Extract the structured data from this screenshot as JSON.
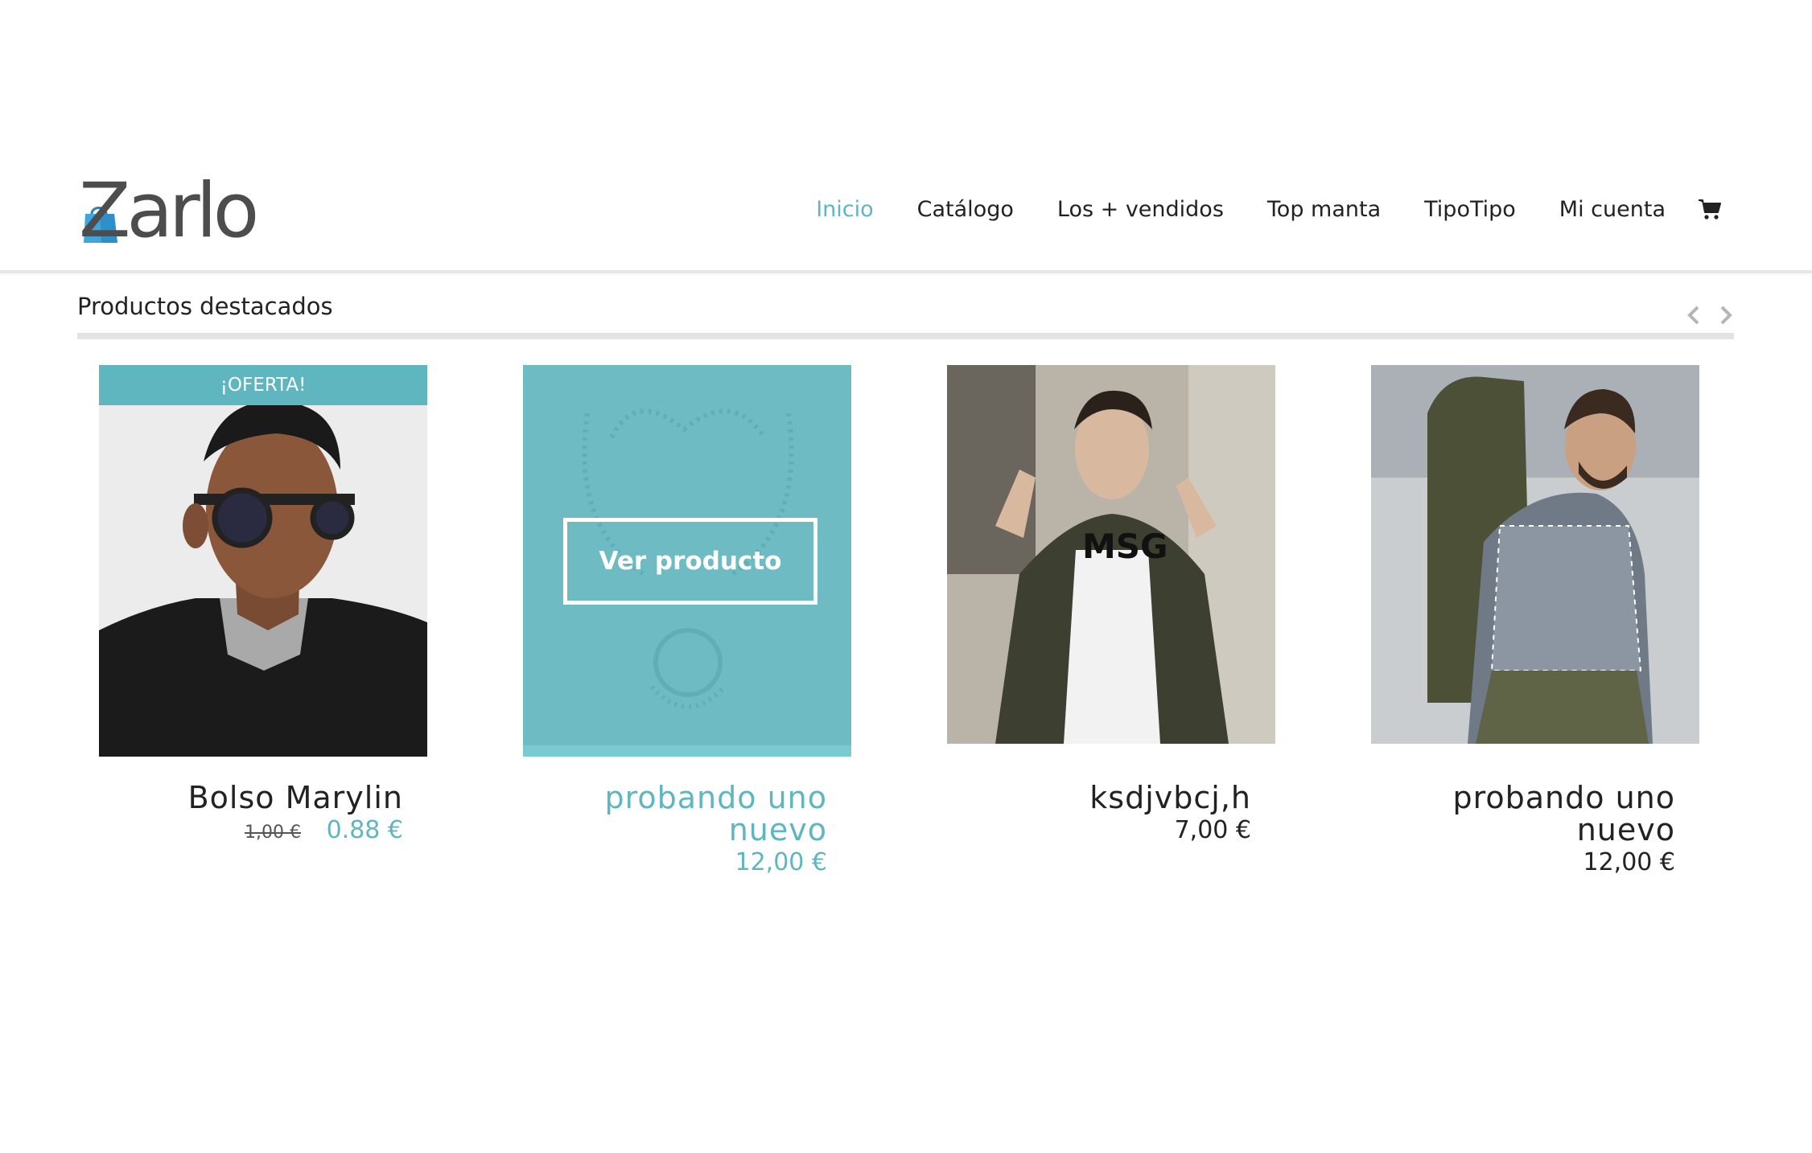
{
  "brand": {
    "name": "Zarlo"
  },
  "nav": {
    "items": [
      "Inicio",
      "Catálogo",
      "Los + vendidos",
      "Top manta",
      "TipoTipo",
      "Mi cuenta"
    ],
    "active": "Inicio",
    "cart_icon": "cart-icon"
  },
  "section": {
    "title": "Productos destacados",
    "prev_icon": "chevron-left-icon",
    "next_icon": "chevron-right-icon"
  },
  "products": [
    {
      "name": "Bolso Marylin",
      "old_price": "1,00 €",
      "price": "0.88 €",
      "badge": "¡OFERTA!"
    },
    {
      "name_line1": "probando uno",
      "name_line2": "nuevo",
      "price": "12,00 €",
      "overlay_button": "Ver producto"
    },
    {
      "name": "ksdjvbcj,h",
      "price": "7,00 €"
    },
    {
      "name_line1": "probando uno",
      "name_line2": "nuevo",
      "price": "12,00 €"
    }
  ],
  "colors": {
    "accent": "#5fb6bf",
    "text": "#222222",
    "rule": "#e3e3e3"
  }
}
